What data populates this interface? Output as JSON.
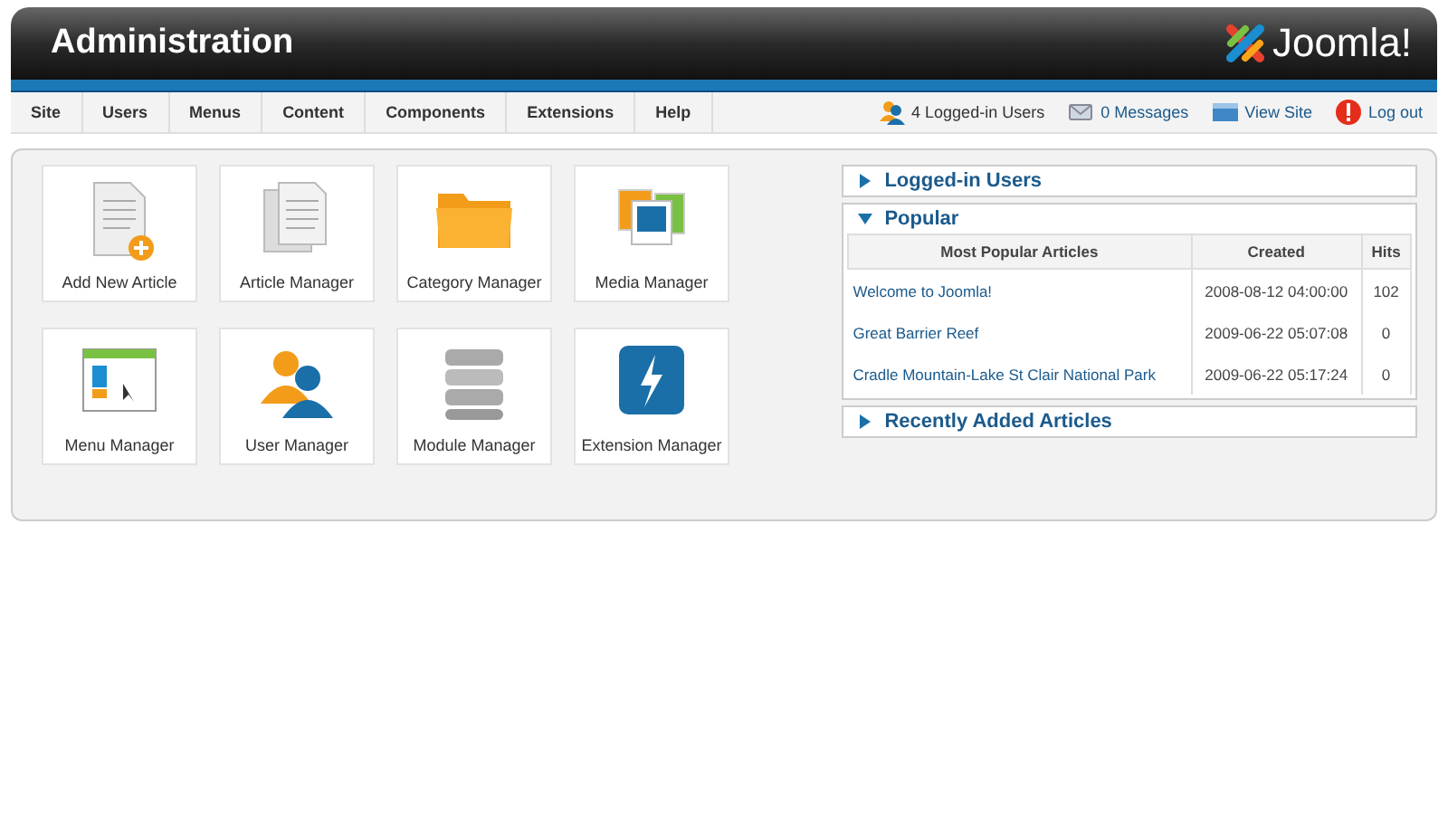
{
  "header": {
    "title": "Administration",
    "logo_text": "Joomla!"
  },
  "menu": [
    "Site",
    "Users",
    "Menus",
    "Content",
    "Components",
    "Extensions",
    "Help"
  ],
  "status": [
    {
      "kind": "users",
      "label": "4 Logged-in Users"
    },
    {
      "kind": "messages",
      "label": "0 Messages"
    },
    {
      "kind": "site",
      "label": "View Site"
    },
    {
      "kind": "logout",
      "label": "Log out"
    }
  ],
  "quickicons": [
    {
      "kind": "add-article",
      "label": "Add New Article"
    },
    {
      "kind": "articles",
      "label": "Article Manager"
    },
    {
      "kind": "folder",
      "label": "Category Manager"
    },
    {
      "kind": "media",
      "label": "Media Manager"
    },
    {
      "kind": "menu",
      "label": "Menu Manager"
    },
    {
      "kind": "users",
      "label": "User Manager"
    },
    {
      "kind": "modules",
      "label": "Module Manager"
    },
    {
      "kind": "extensions",
      "label": "Extension Manager"
    }
  ],
  "panels": [
    {
      "title": "Logged-in Users",
      "expanded": false
    },
    {
      "title": "Popular",
      "expanded": true,
      "table": {
        "columns": [
          "Most Popular Articles",
          "Created",
          "Hits"
        ],
        "rows": [
          [
            "Welcome to Joomla!",
            "2008-08-12 04:00:00",
            "102"
          ],
          [
            "Great Barrier Reef",
            "2009-06-22 05:07:08",
            "0"
          ],
          [
            "Cradle Mountain-Lake St Clair National Park",
            "2009-06-22 05:17:24",
            "0"
          ]
        ]
      }
    },
    {
      "title": "Recently Added Articles",
      "expanded": false
    }
  ]
}
